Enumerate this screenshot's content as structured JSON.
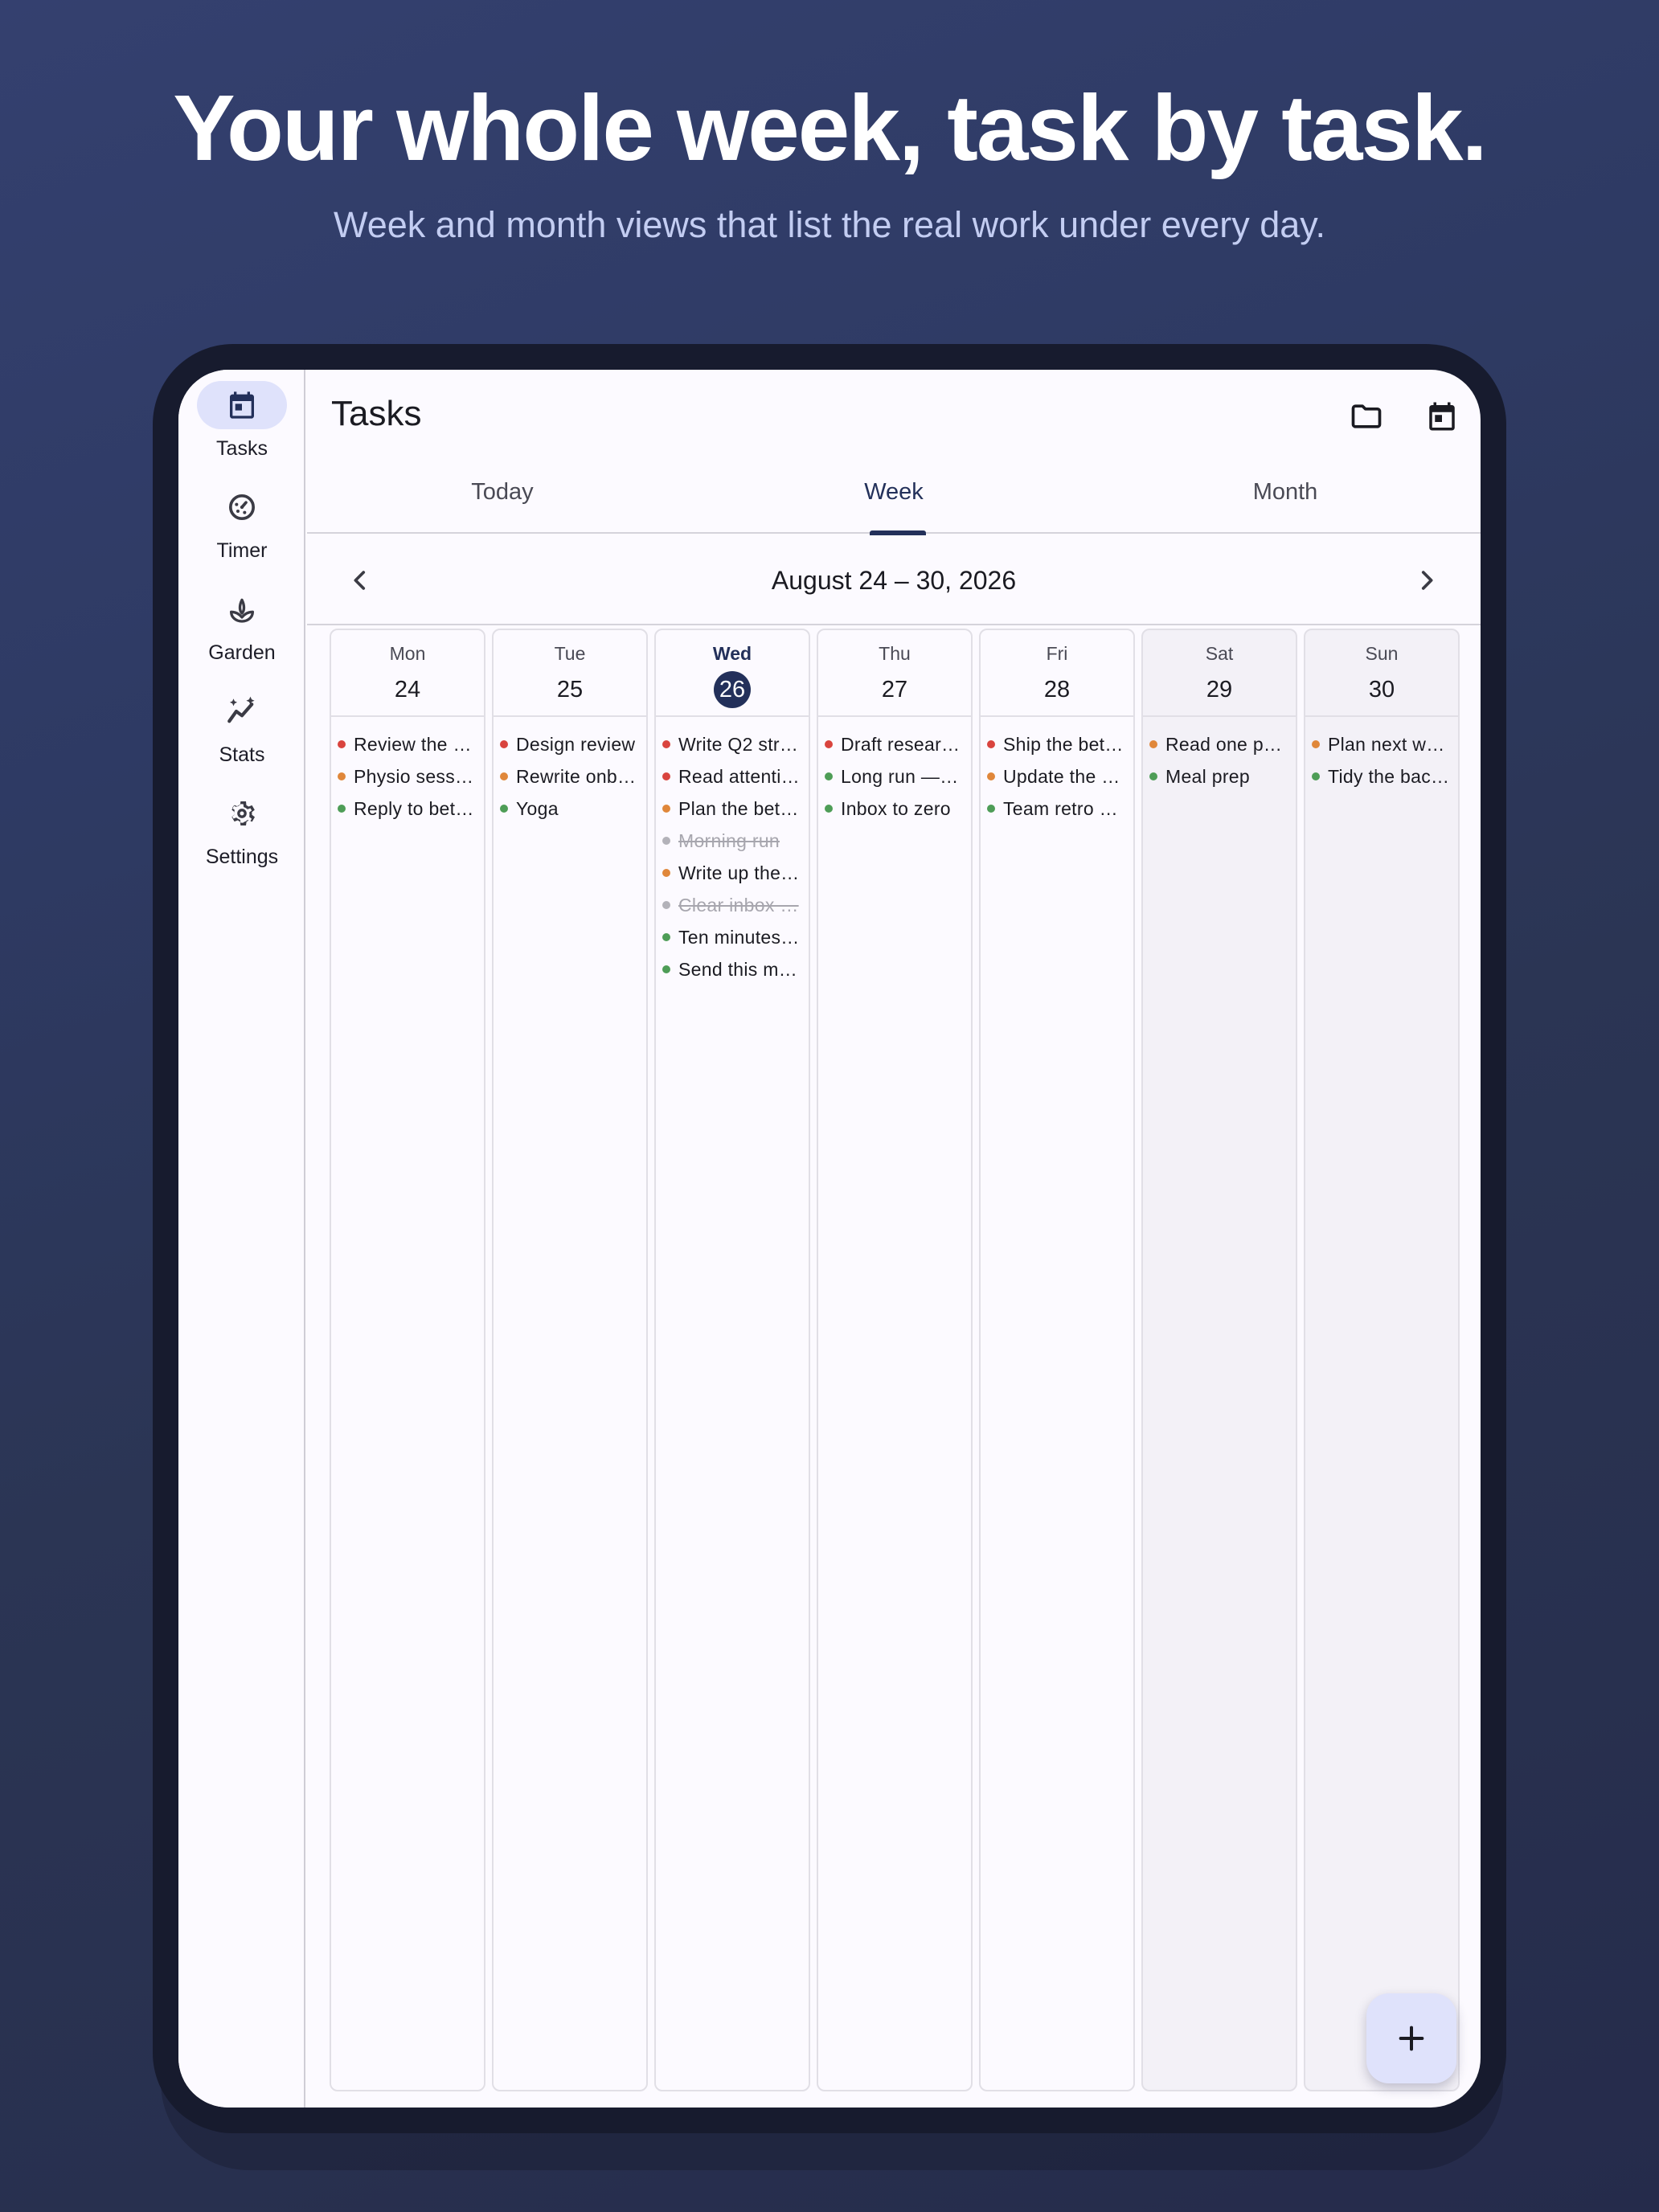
{
  "hero": {
    "title": "Your whole week, task by task.",
    "subtitle": "Week and month views that list the real work under every day."
  },
  "nav": {
    "items": [
      {
        "label": "Tasks",
        "icon": "calendar-icon",
        "active": true
      },
      {
        "label": "Timer",
        "icon": "timer-icon",
        "active": false
      },
      {
        "label": "Garden",
        "icon": "sprout-icon",
        "active": false
      },
      {
        "label": "Stats",
        "icon": "stats-sparkle-icon",
        "active": false
      },
      {
        "label": "Settings",
        "icon": "gear-icon",
        "active": false
      }
    ]
  },
  "header": {
    "title": "Tasks",
    "actions": [
      "folder-icon",
      "calendar-icon"
    ]
  },
  "tabs": [
    {
      "label": "Today",
      "active": false
    },
    {
      "label": "Week",
      "active": true
    },
    {
      "label": "Month",
      "active": false
    }
  ],
  "week": {
    "range": "August 24 – 30, 2026",
    "days": [
      {
        "dow": "Mon",
        "num": "24",
        "tasks": [
          {
            "text": "Review the …",
            "color": "#d9443e"
          },
          {
            "text": "Physio sessi…",
            "color": "#e0873a"
          },
          {
            "text": "Reply to bet…",
            "color": "#4e9d57"
          }
        ]
      },
      {
        "dow": "Tue",
        "num": "25",
        "tasks": [
          {
            "text": "Design review",
            "color": "#d9443e"
          },
          {
            "text": "Rewrite onb…",
            "color": "#e0873a"
          },
          {
            "text": "Yoga",
            "color": "#4e9d57"
          }
        ]
      },
      {
        "dow": "Wed",
        "num": "26",
        "today": true,
        "tasks": [
          {
            "text": "Write Q2 str…",
            "color": "#d9443e"
          },
          {
            "text": "Read attenti…",
            "color": "#d9443e"
          },
          {
            "text": "Plan the bet…",
            "color": "#e0873a"
          },
          {
            "text": "Morning run",
            "color": "#b3b2b9",
            "done": true
          },
          {
            "text": "Write up the…",
            "color": "#e0873a"
          },
          {
            "text": "Clear inbox …",
            "color": "#b3b2b9",
            "done": true
          },
          {
            "text": "Ten minutes…",
            "color": "#4e9d57"
          },
          {
            "text": "Send this m…",
            "color": "#4e9d57"
          }
        ]
      },
      {
        "dow": "Thu",
        "num": "27",
        "tasks": [
          {
            "text": "Draft resear…",
            "color": "#d9443e"
          },
          {
            "text": "Long run — …",
            "color": "#4e9d57"
          },
          {
            "text": "Inbox to zero",
            "color": "#4e9d57"
          }
        ]
      },
      {
        "dow": "Fri",
        "num": "28",
        "tasks": [
          {
            "text": "Ship the bet…",
            "color": "#d9443e"
          },
          {
            "text": "Update the r…",
            "color": "#e0873a"
          },
          {
            "text": "Team retro …",
            "color": "#4e9d57"
          }
        ]
      },
      {
        "dow": "Sat",
        "num": "29",
        "weekend": true,
        "tasks": [
          {
            "text": "Read one p…",
            "color": "#e0873a"
          },
          {
            "text": "Meal prep",
            "color": "#4e9d57"
          }
        ]
      },
      {
        "dow": "Sun",
        "num": "30",
        "weekend": true,
        "tasks": [
          {
            "text": "Plan next w…",
            "color": "#e0873a"
          },
          {
            "text": "Tidy the bac…",
            "color": "#4e9d57"
          }
        ]
      }
    ]
  },
  "fab": {
    "icon": "plus-icon"
  }
}
